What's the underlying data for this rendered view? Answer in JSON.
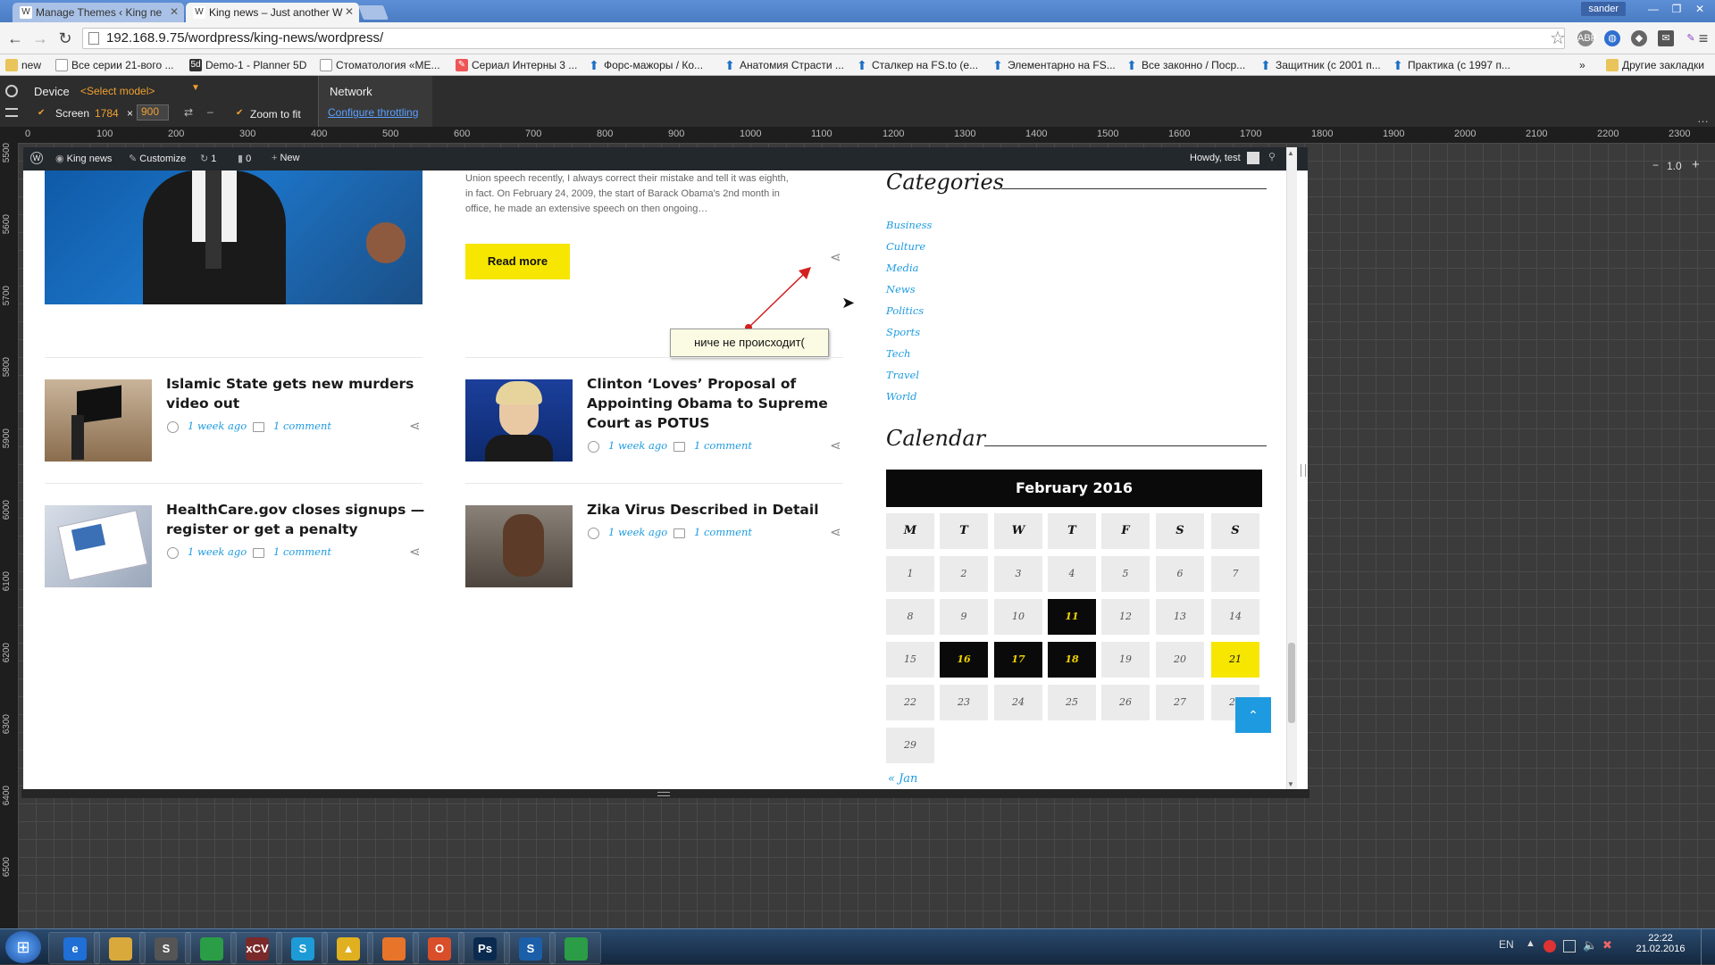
{
  "browser": {
    "tabs": [
      {
        "title": "Manage Themes ‹ King ne",
        "active": false
      },
      {
        "title": "King news – Just another W",
        "active": true
      }
    ],
    "user": "sander",
    "url": "192.168.9.75/wordpress/king-news/wordpress/",
    "bookmarks": [
      {
        "label": "new",
        "icon": "folder-icon"
      },
      {
        "label": "Все серии 21-вого ...",
        "icon": "page-icon"
      },
      {
        "label": "Demo-1 - Planner 5D",
        "icon": "planner-icon"
      },
      {
        "label": "Стоматология «МЕ...",
        "icon": "page-icon"
      },
      {
        "label": "Сериал Интерны 3 ...",
        "icon": "pen-icon"
      },
      {
        "label": "Форс-мажоры / Ко...",
        "icon": "arrow-icon"
      },
      {
        "label": "Анатомия Страсти ...",
        "icon": "arrow-icon"
      },
      {
        "label": "Сталкер на FS.to (е...",
        "icon": "arrow-icon"
      },
      {
        "label": "Элементарно на FS...",
        "icon": "arrow-icon"
      },
      {
        "label": "Все законно / Поср...",
        "icon": "arrow-icon"
      },
      {
        "label": "Защитник (с 2001 п...",
        "icon": "arrow-icon"
      },
      {
        "label": "Практика (с 1997 п...",
        "icon": "arrow-icon"
      }
    ],
    "bookmarks_more": "»",
    "other_bookmarks": "Другие закладки"
  },
  "devtools": {
    "device_label": "Device",
    "model_select": "<Select model>",
    "screen_label": "Screen",
    "screen_width": "1784",
    "screen_x": "×",
    "screen_height": "900",
    "zoom_to_fit": "Zoom to fit",
    "network_label": "Network",
    "throttling_link": "Configure throttling",
    "zoom_value": "1.0",
    "ruler_ticks": [
      "0",
      "100",
      "200",
      "300",
      "400",
      "500",
      "600",
      "700",
      "800",
      "900",
      "1000",
      "1100",
      "1200",
      "1300",
      "1400",
      "1500",
      "1600",
      "1700",
      "1800",
      "1900",
      "2000",
      "2100",
      "2200",
      "2300"
    ],
    "vruler_ticks": [
      "5500",
      "5600",
      "5700",
      "5800",
      "5900",
      "6000",
      "6100",
      "6200",
      "6300",
      "6400",
      "6500"
    ]
  },
  "wp_admin_bar": {
    "site": "King news",
    "customize": "Customize",
    "updates": "1",
    "comments": "0",
    "new": "New",
    "howdy": "Howdy, test"
  },
  "featured": {
    "excerpt_line1": "Union speech recently, I always correct their mistake and tell it was eighth,",
    "excerpt_line2": "in fact. On February 24, 2009, the start of Barack Obama's 2nd month in",
    "excerpt_line3": "office, he made an extensive speech on then ongoing…",
    "read_more": "Read more"
  },
  "annotation": {
    "note": "ниче не происходит("
  },
  "posts": [
    {
      "title_lines": [
        "Islamic State gets new murders",
        "video out"
      ],
      "date": "1 week ago",
      "comments": "1 comment"
    },
    {
      "title_lines": [
        "Clinton ‘Loves’ Proposal of",
        "Appointing Obama to Supreme",
        "Court as POTUS"
      ],
      "date": "1 week ago",
      "comments": "1 comment"
    },
    {
      "title_lines": [
        "HealthCare.gov closes signups —",
        "register or get a penalty"
      ],
      "date": "1 week ago",
      "comments": "1 comment"
    },
    {
      "title_lines": [
        "Zika Virus Described in Detail"
      ],
      "date": "1 week ago",
      "comments": "1 comment"
    }
  ],
  "sidebar": {
    "categories_title": "Categories",
    "categories": [
      "Business",
      "Culture",
      "Media",
      "News",
      "Politics",
      "Sports",
      "Tech",
      "Travel",
      "World"
    ],
    "calendar_title": "Calendar",
    "calendar": {
      "caption": "February 2016",
      "weekdays": [
        "M",
        "T",
        "W",
        "T",
        "F",
        "S",
        "S"
      ],
      "days": [
        "1",
        "2",
        "3",
        "4",
        "5",
        "6",
        "7",
        "8",
        "9",
        "10",
        "11",
        "12",
        "13",
        "14",
        "15",
        "16",
        "17",
        "18",
        "19",
        "20",
        "21",
        "22",
        "23",
        "24",
        "25",
        "26",
        "27",
        "28",
        "29"
      ],
      "dark_days": [
        "11",
        "16",
        "17",
        "18"
      ],
      "today": "21",
      "prev_link": "« Jan"
    }
  },
  "taskbar": {
    "apps": [
      {
        "icon": "ie-icon",
        "label": "e"
      },
      {
        "icon": "explorer-icon",
        "label": ""
      },
      {
        "icon": "sublime-icon",
        "label": "S"
      },
      {
        "icon": "chrome-icon",
        "label": ""
      },
      {
        "icon": "xcv-icon",
        "label": "xCV"
      },
      {
        "icon": "skype-icon",
        "label": "S"
      },
      {
        "icon": "drive-icon",
        "label": "▲"
      },
      {
        "icon": "firefox-icon",
        "label": ""
      },
      {
        "icon": "office-icon",
        "label": "O"
      },
      {
        "icon": "photoshop-icon",
        "label": "Ps"
      },
      {
        "icon": "snagit-icon",
        "label": "S"
      },
      {
        "icon": "chrome-dev-icon",
        "label": ""
      }
    ],
    "lang": "EN",
    "time": "22:22",
    "date": "21.02.2016"
  },
  "colors": {
    "accent_yellow": "#f7e600",
    "link_blue": "#1e9be0",
    "calendar_dark": "#0a0a0a"
  }
}
